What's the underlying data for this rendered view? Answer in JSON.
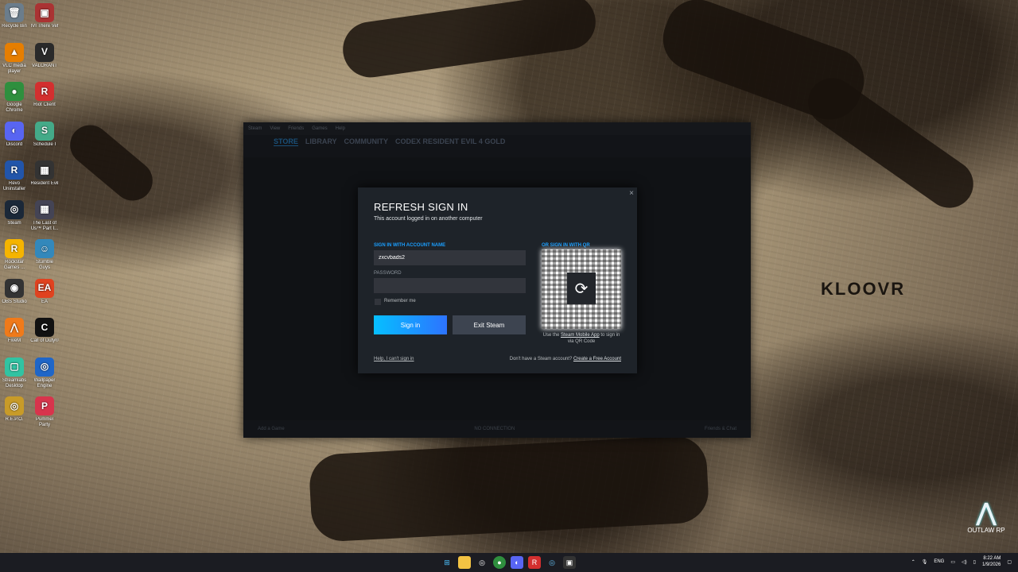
{
  "desktop": {
    "icons": [
      {
        "label": "Recycle Bin",
        "glyph": "🗑",
        "color": "#6b7d8c"
      },
      {
        "label": "IVI There Vef",
        "glyph": "▣",
        "color": "#a33"
      },
      {
        "label": "VLC media player",
        "glyph": "▲",
        "color": "#e67e00"
      },
      {
        "label": "VALORANT",
        "glyph": "V",
        "color": "#2a2a2a"
      },
      {
        "label": "Google Chrome",
        "glyph": "●",
        "color": "#2f8f3e"
      },
      {
        "label": "Riot Client",
        "glyph": "R",
        "color": "#d32f2f"
      },
      {
        "label": "Discord",
        "glyph": "◐",
        "color": "#5865f2"
      },
      {
        "label": "Schedule I",
        "glyph": "S",
        "color": "#4a8"
      },
      {
        "label": "Revo Uninstaller",
        "glyph": "R",
        "color": "#2255aa"
      },
      {
        "label": "Resident Evil",
        "glyph": "▦",
        "color": "#333"
      },
      {
        "label": "Steam",
        "glyph": "◎",
        "color": "#1b2838"
      },
      {
        "label": "The Last of Us™ Part I...",
        "glyph": "▦",
        "color": "#445"
      },
      {
        "label": "Rockstar Games ...",
        "glyph": "R",
        "color": "#f5b400"
      },
      {
        "label": "Stumble Guys",
        "glyph": "☺",
        "color": "#38b"
      },
      {
        "label": "OBS Studio",
        "glyph": "◉",
        "color": "#333"
      },
      {
        "label": "EA",
        "glyph": "EA",
        "color": "#e0421f"
      },
      {
        "label": "FiveM",
        "glyph": "⋀",
        "color": "#f07a1a"
      },
      {
        "label": "Call of Duty®",
        "glyph": "C",
        "color": "#111"
      },
      {
        "label": "Streamlabs Desktop",
        "glyph": "▢",
        "color": "#31c3a2"
      },
      {
        "label": "Wallpaper Engine",
        "glyph": "◎",
        "color": "#1f66c8"
      },
      {
        "label": "R.E.P.O.",
        "glyph": "◎",
        "color": "#c89b28"
      },
      {
        "label": "Pummel Party",
        "glyph": "P",
        "color": "#d8344c"
      }
    ]
  },
  "steam": {
    "titlebar": [
      "Steam",
      "View",
      "Friends",
      "Games",
      "Help"
    ],
    "nav": [
      "STORE",
      "LIBRARY",
      "COMMUNITY",
      "CODEX RESIDENT EVIL 4 GOLD"
    ],
    "statusbar": {
      "left": "Add a Game",
      "center": "NO CONNECTION",
      "right": "Friends & Chat"
    }
  },
  "dialog": {
    "title": "REFRESH SIGN IN",
    "subtitle": "This account logged in on another computer",
    "account_label": "SIGN IN WITH ACCOUNT NAME",
    "account_value": "zxcvbads2",
    "password_label": "PASSWORD",
    "password_value": "",
    "remember_label": "Remember me",
    "signin_label": "Sign in",
    "exit_label": "Exit Steam",
    "qr_label": "OR SIGN IN WITH QR",
    "qr_caption_pre": "Use the",
    "qr_caption_link": "Steam Mobile App",
    "qr_caption_post": "to sign in via QR Code",
    "help_link": "Help, I can't sign in",
    "no_account": "Don't have a Steam account?",
    "create_link": "Create a Free Account",
    "close_glyph": "×"
  },
  "watermark": {
    "kloovr": "KLOOVR",
    "outlaw": "OUTLAW RP"
  },
  "taskbar": {
    "apps": [
      "start",
      "explorer",
      "obs",
      "chrome",
      "discord",
      "riot",
      "steam",
      "terminal"
    ],
    "tray": {
      "lang": "ENG",
      "time": "8:22 AM",
      "date": "1/9/2026"
    }
  }
}
